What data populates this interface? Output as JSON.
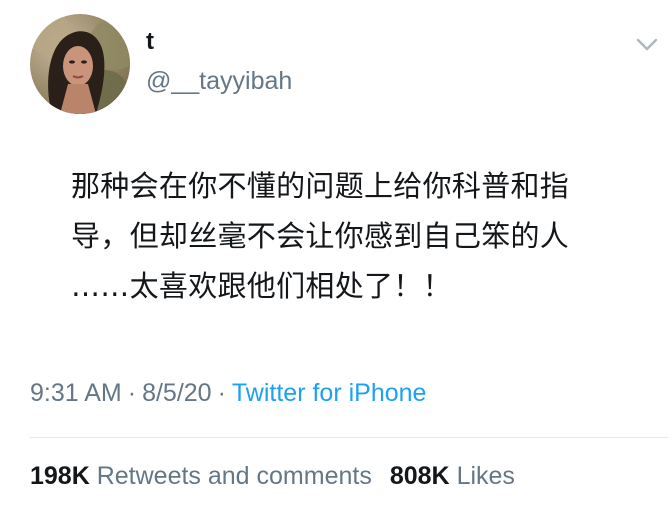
{
  "tweet": {
    "author": {
      "display_name": "t",
      "handle": "@__tayyibah",
      "avatar": "profile-photo"
    },
    "menu_icon": "chevron-down-icon",
    "text": "那种会在你不懂的问题上给你科普和指\n导，但却丝毫不会让你感到自己笨的人\n……太喜欢跟他们相处了！！",
    "time": "9:31 AM",
    "date": "8/5/20",
    "separator": "·",
    "source": "Twitter for iPhone",
    "stats": {
      "retweets_count": "198K",
      "retweets_label": "Retweets and comments",
      "likes_count": "808K",
      "likes_label": "Likes"
    }
  },
  "colors": {
    "text_primary": "#14171a",
    "text_secondary": "#657786",
    "link": "#1da1f2",
    "divider": "#e1e8ed"
  }
}
